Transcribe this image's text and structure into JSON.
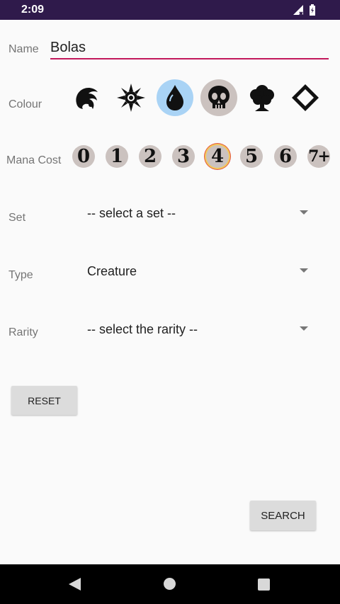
{
  "status_bar": {
    "time": "2:09"
  },
  "form": {
    "name_label": "Name",
    "name_value": "Bolas",
    "colour_label": "Colour",
    "colours": [
      {
        "name": "red-mana-icon",
        "selected": false
      },
      {
        "name": "white-mana-icon",
        "selected": false
      },
      {
        "name": "blue-mana-icon",
        "selected": true
      },
      {
        "name": "black-mana-icon",
        "selected": false
      },
      {
        "name": "green-mana-icon",
        "selected": false
      },
      {
        "name": "colorless-mana-icon",
        "selected": false
      }
    ],
    "mana_label": "Mana Cost",
    "mana_values": [
      "0",
      "1",
      "2",
      "3",
      "4",
      "5",
      "6",
      "7+"
    ],
    "mana_selected": "4",
    "set_label": "Set",
    "set_value": "-- select a set --",
    "type_label": "Type",
    "type_value": "Creature",
    "rarity_label": "Rarity",
    "rarity_value": "-- select the rarity --",
    "reset_label": "RESET",
    "search_label": "SEARCH"
  },
  "colors": {
    "accent": "#c2185b",
    "status_bar": "#2f1a4b",
    "selected_colour_bg": "#a9d3f5"
  }
}
